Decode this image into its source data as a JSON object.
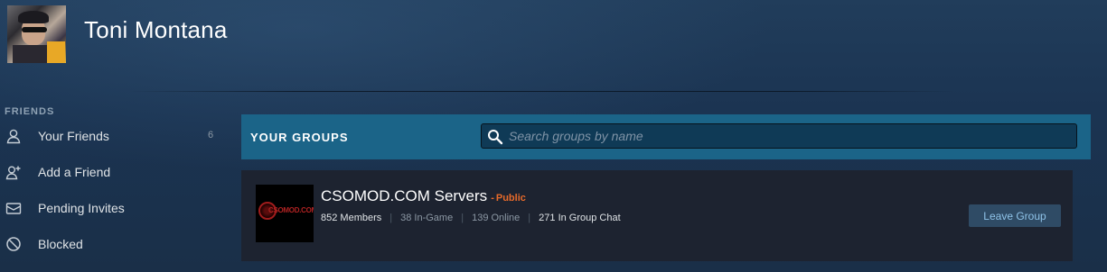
{
  "profile": {
    "name": "Toni Montana"
  },
  "sidebar": {
    "heading": "FRIENDS",
    "items": [
      {
        "label": "Your Friends",
        "count": "6",
        "icon": "person-icon"
      },
      {
        "label": "Add a Friend",
        "count": "",
        "icon": "add-person-icon"
      },
      {
        "label": "Pending Invites",
        "count": "",
        "icon": "envelope-icon"
      },
      {
        "label": "Blocked",
        "count": "",
        "icon": "blocked-icon"
      }
    ]
  },
  "groups_panel": {
    "title": "YOUR GROUPS",
    "search_placeholder": "Search groups by name"
  },
  "groups": [
    {
      "name": "CSOMOD.COM Servers",
      "visibility": "Public",
      "members": "852 Members",
      "in_game": "38 In-Game",
      "online": "139 Online",
      "in_chat": "271 In Group Chat",
      "avatar_text": "CSOMOD.COM",
      "leave_label": "Leave Group"
    }
  ],
  "colors": {
    "accent_header": "#1b6488",
    "public_tag": "#e76a2a",
    "card_bg": "#1d2330",
    "button_bg": "#2f4b65"
  }
}
